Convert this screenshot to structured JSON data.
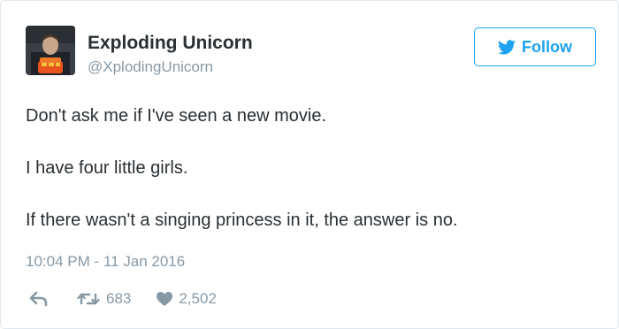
{
  "author": {
    "display_name": "Exploding Unicorn",
    "handle": "@XplodingUnicorn"
  },
  "follow_button": {
    "label": "Follow",
    "icon": "twitter-bird-icon"
  },
  "tweet": {
    "lines": [
      "Don't ask me if I've seen a new movie.",
      "I have four little girls.",
      "If there wasn't a singing princess in it, the answer is no."
    ],
    "timestamp": "10:04 PM - 11 Jan 2016"
  },
  "actions": {
    "reply_icon": "reply-icon",
    "retweet_icon": "retweet-icon",
    "retweet_count": "683",
    "like_icon": "heart-icon",
    "like_count": "2,502"
  },
  "colors": {
    "accent": "#1da1f2",
    "muted": "#8899a6",
    "text": "#292f33"
  }
}
